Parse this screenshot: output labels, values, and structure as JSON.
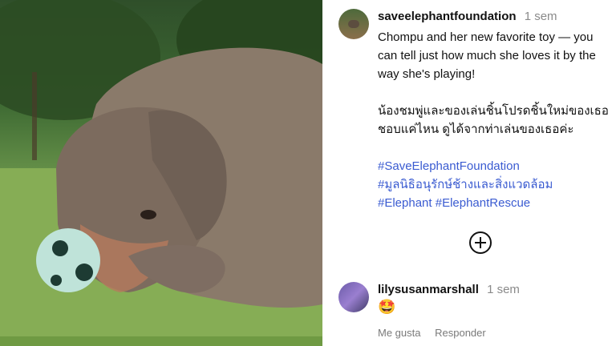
{
  "post": {
    "username": "saveelephantfoundation",
    "time": "1 sem",
    "caption_en": "Chompu and her new favorite toy — you can tell just how much she loves it by the way she's playing!",
    "caption_th": "น้องชมพู่และของเล่นชิ้นโปรดชิ้นใหม่ของเธอ ชอบแค่ไหน ดูได้จากท่าเล่นของเธอค่ะ",
    "hashtags": [
      "#SaveElephantFoundation",
      "#มูลนิธิอนุรักษ์ช้างและสิ่งแวดล้อม",
      "#Elephant #ElephantRescue"
    ]
  },
  "comment": {
    "username": "lilysusanmarshall",
    "time": "1 sem",
    "text": "🤩",
    "like_label": "Me gusta",
    "reply_label": "Responder"
  },
  "icons": {
    "load_more": "plus-circle-icon"
  },
  "colors": {
    "hashtag": "#3a5bd1",
    "muted": "#8a8a8a"
  }
}
